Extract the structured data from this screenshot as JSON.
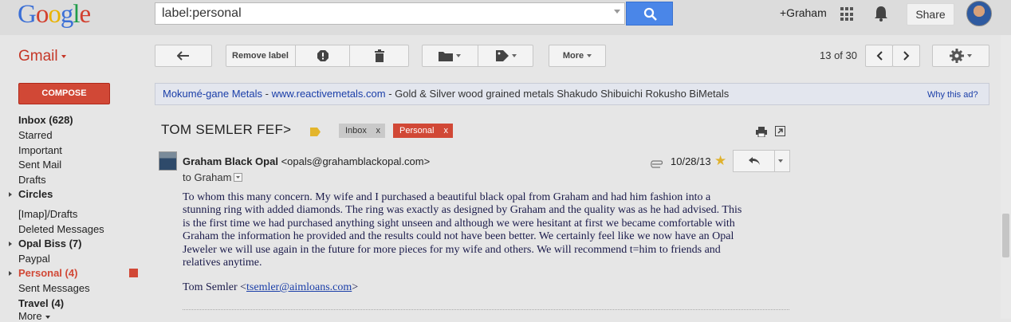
{
  "header": {
    "logo": "Google",
    "search_value": "label:personal",
    "user_link": "+Graham",
    "share_label": "Share"
  },
  "toolbar": {
    "app_label": "Gmail",
    "remove_label": "Remove label",
    "more_label": "More",
    "pager": "13 of 30"
  },
  "sidebar": {
    "compose": "COMPOSE",
    "items": [
      {
        "label": "Inbox (628)"
      },
      {
        "label": "Starred"
      },
      {
        "label": "Important"
      },
      {
        "label": "Sent Mail"
      },
      {
        "label": "Drafts"
      },
      {
        "label": "Circles"
      },
      {
        "label": "[Imap]/Drafts"
      },
      {
        "label": "Deleted Messages"
      },
      {
        "label": "Opal Biss (7)"
      },
      {
        "label": "Paypal"
      },
      {
        "label": "Personal (4)"
      },
      {
        "label": "Sent Messages"
      },
      {
        "label": "Travel (4)"
      },
      {
        "label": "More"
      }
    ],
    "personal_color": "#d14836"
  },
  "ad": {
    "title": "Mokumé-gane Metals",
    "dash1": " - ",
    "url": "www.reactivemetals.com",
    "text": " - Gold & Silver wood grained metals Shakudo Shibuichi Rokusho BiMetals",
    "why": "Why this ad?"
  },
  "message": {
    "subject": "TOM SEMLER FEF>",
    "labels": [
      "Inbox",
      "Personal"
    ],
    "label_close": "x",
    "sender_name": "Graham Black Opal",
    "sender_email": "<opals@grahamblackopal.com>",
    "to": "to Graham",
    "date": "10/28/13",
    "body": [
      "To whom this many concern.  My wife and I purchased a beautiful black opal from Graham and had him fashion into a",
      "stunning ring with added diamonds.  The ring was exactly as designed by Graham and the quality was as he had advised.  This",
      "is the first time we had purchased anything sight unseen and although we were hesitant at first we became comfortable with",
      "Graham the information he provided and the results could not have been better.  We certainly feel like we now have an Opal",
      "Jeweler we will use again in the future for more pieces for my wife and others.  We will recommend t=him to friends and",
      "relatives anytime."
    ],
    "signature_name": "Tom Semler <",
    "signature_email": "tsemler@aimloans.com",
    "signature_end": ">"
  },
  "colors": {
    "accent_red": "#d14836",
    "search_blue": "#4a86e8",
    "link_blue": "#1a3ea8"
  },
  "icons": [
    "search-icon",
    "apps-grid-icon",
    "notification-bell-icon",
    "back-arrow-icon",
    "report-spam-icon",
    "trash-icon",
    "folder-icon",
    "label-tag-icon",
    "settings-gear-icon",
    "print-icon",
    "new-window-icon",
    "paperclip-icon",
    "star-icon",
    "reply-icon",
    "important-marker-icon"
  ]
}
